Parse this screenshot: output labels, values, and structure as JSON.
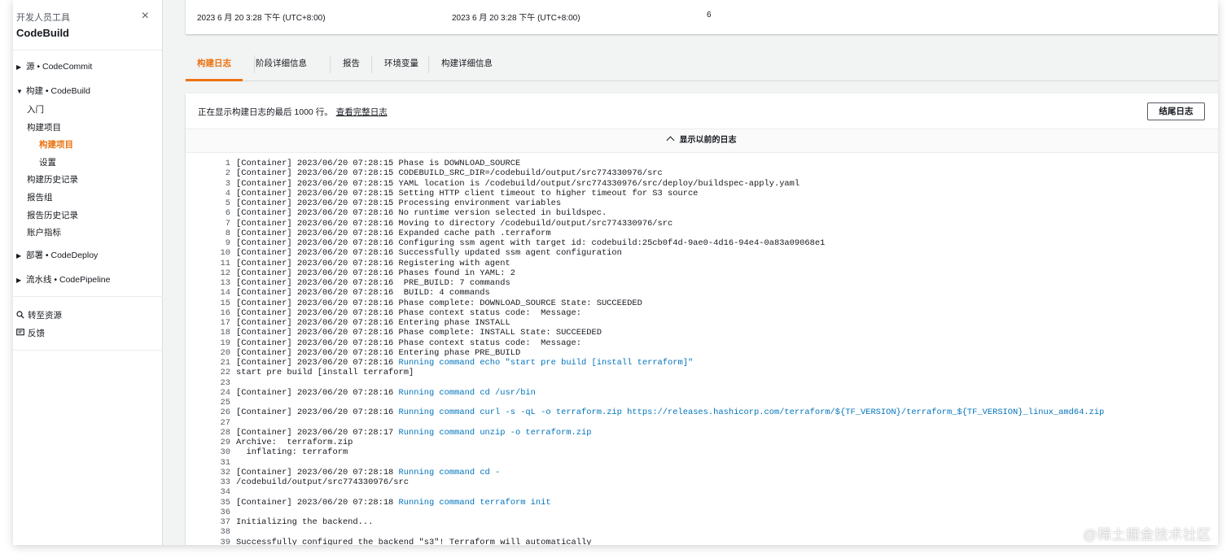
{
  "sidebar": {
    "subtitle": "开发人员工具",
    "title": "CodeBuild",
    "close_icon": "×",
    "sections": {
      "source": "源 • CodeCommit",
      "build": "构建 • CodeBuild",
      "deploy": "部署 • CodeDeploy",
      "pipeline": "流水线 • CodePipeline"
    },
    "build_items": {
      "getting_started": "入门",
      "projects": "构建项目",
      "project_active": "构建项目",
      "settings": "设置",
      "history": "构建历史记录",
      "report_groups": "报告组",
      "report_history": "报告历史记录",
      "account_metrics": "账户指标"
    },
    "footer": {
      "go_to_resource": "转至资源",
      "feedback": "反馈"
    }
  },
  "summary": {
    "start_time": "2023 6 月 20 3:28 下午 (UTC+8:00)",
    "end_time": "2023 6 月 20 3:28 下午 (UTC+8:00)",
    "count": "6"
  },
  "tabs": {
    "build_logs": "构建日志",
    "phase_details": "阶段详细信息",
    "reports": "报告",
    "env_vars": "环境变量",
    "build_details": "构建详细信息"
  },
  "logs": {
    "notice": "正在显示构建日志的最后 1000 行。",
    "full_log_link": "查看完整日志",
    "tail_button": "结尾日志",
    "show_previous": "显示以前的日志",
    "lines": [
      {
        "n": "1",
        "t": "[Container] 2023/06/20 07:28:15 Phase is DOWNLOAD_SOURCE",
        "c": ""
      },
      {
        "n": "2",
        "t": "[Container] 2023/06/20 07:28:15 CODEBUILD_SRC_DIR=/codebuild/output/src774330976/src",
        "c": ""
      },
      {
        "n": "3",
        "t": "[Container] 2023/06/20 07:28:15 YAML location is /codebuild/output/src774330976/src/deploy/buildspec-apply.yaml",
        "c": ""
      },
      {
        "n": "4",
        "t": "[Container] 2023/06/20 07:28:15 Setting HTTP client timeout to higher timeout for S3 source",
        "c": ""
      },
      {
        "n": "5",
        "t": "[Container] 2023/06/20 07:28:15 Processing environment variables",
        "c": ""
      },
      {
        "n": "6",
        "t": "[Container] 2023/06/20 07:28:16 No runtime version selected in buildspec.",
        "c": ""
      },
      {
        "n": "7",
        "t": "[Container] 2023/06/20 07:28:16 Moving to directory /codebuild/output/src774330976/src",
        "c": ""
      },
      {
        "n": "8",
        "t": "[Container] 2023/06/20 07:28:16 Expanded cache path .terraform",
        "c": ""
      },
      {
        "n": "9",
        "t": "[Container] 2023/06/20 07:28:16 Configuring ssm agent with target id: codebuild:25cb0f4d-9ae0-4d16-94e4-0a83a09068e1",
        "c": ""
      },
      {
        "n": "10",
        "t": "[Container] 2023/06/20 07:28:16 Successfully updated ssm agent configuration",
        "c": ""
      },
      {
        "n": "11",
        "t": "[Container] 2023/06/20 07:28:16 Registering with agent",
        "c": ""
      },
      {
        "n": "12",
        "t": "[Container] 2023/06/20 07:28:16 Phases found in YAML: 2",
        "c": ""
      },
      {
        "n": "13",
        "t": "[Container] 2023/06/20 07:28:16  PRE_BUILD: 7 commands",
        "c": ""
      },
      {
        "n": "14",
        "t": "[Container] 2023/06/20 07:28:16  BUILD: 4 commands",
        "c": ""
      },
      {
        "n": "15",
        "t": "[Container] 2023/06/20 07:28:16 Phase complete: DOWNLOAD_SOURCE State: SUCCEEDED",
        "c": ""
      },
      {
        "n": "16",
        "t": "[Container] 2023/06/20 07:28:16 Phase context status code:  Message:",
        "c": ""
      },
      {
        "n": "17",
        "t": "[Container] 2023/06/20 07:28:16 Entering phase INSTALL",
        "c": ""
      },
      {
        "n": "18",
        "t": "[Container] 2023/06/20 07:28:16 Phase complete: INSTALL State: SUCCEEDED",
        "c": ""
      },
      {
        "n": "19",
        "t": "[Container] 2023/06/20 07:28:16 Phase context status code:  Message:",
        "c": ""
      },
      {
        "n": "20",
        "t": "[Container] 2023/06/20 07:28:16 Entering phase PRE_BUILD",
        "c": ""
      },
      {
        "n": "21",
        "t": "[Container] 2023/06/20 07:28:16 ",
        "c": "Running command echo \"start pre build [install terraform]\""
      },
      {
        "n": "22",
        "t": "start pre build [install terraform]",
        "c": ""
      },
      {
        "n": "23",
        "t": "",
        "c": ""
      },
      {
        "n": "24",
        "t": "[Container] 2023/06/20 07:28:16 ",
        "c": "Running command cd /usr/bin"
      },
      {
        "n": "25",
        "t": "",
        "c": ""
      },
      {
        "n": "26",
        "t": "[Container] 2023/06/20 07:28:16 ",
        "c": "Running command curl -s -qL -o terraform.zip https://releases.hashicorp.com/terraform/${TF_VERSION}/terraform_${TF_VERSION}_linux_amd64.zip"
      },
      {
        "n": "27",
        "t": "",
        "c": ""
      },
      {
        "n": "28",
        "t": "[Container] 2023/06/20 07:28:17 ",
        "c": "Running command unzip -o terraform.zip"
      },
      {
        "n": "29",
        "t": "Archive:  terraform.zip",
        "c": ""
      },
      {
        "n": "30",
        "t": "  inflating: terraform",
        "c": ""
      },
      {
        "n": "31",
        "t": "",
        "c": ""
      },
      {
        "n": "32",
        "t": "[Container] 2023/06/20 07:28:18 ",
        "c": "Running command cd -"
      },
      {
        "n": "33",
        "t": "/codebuild/output/src774330976/src",
        "c": ""
      },
      {
        "n": "34",
        "t": "",
        "c": ""
      },
      {
        "n": "35",
        "t": "[Container] 2023/06/20 07:28:18 ",
        "c": "Running command terraform init"
      },
      {
        "n": "36",
        "t": "",
        "c": ""
      },
      {
        "n": "37",
        "t": "Initializing the backend...",
        "c": ""
      },
      {
        "n": "38",
        "t": "",
        "c": ""
      },
      {
        "n": "39",
        "t": "Successfully configured the backend \"s3\"! Terraform will automatically",
        "c": ""
      }
    ]
  },
  "watermark": "@稀土掘金技术社区",
  "colors": {
    "accent": "#ec7211",
    "command": "#0073bb",
    "text": "#16191f",
    "background": "#f2f3f3"
  },
  "icons": {
    "close": "close-icon",
    "caret_right": "caret-right-icon",
    "caret_down": "caret-down-icon",
    "search": "search-icon",
    "feedback": "feedback-icon",
    "chevron_up": "chevron-up-icon"
  }
}
